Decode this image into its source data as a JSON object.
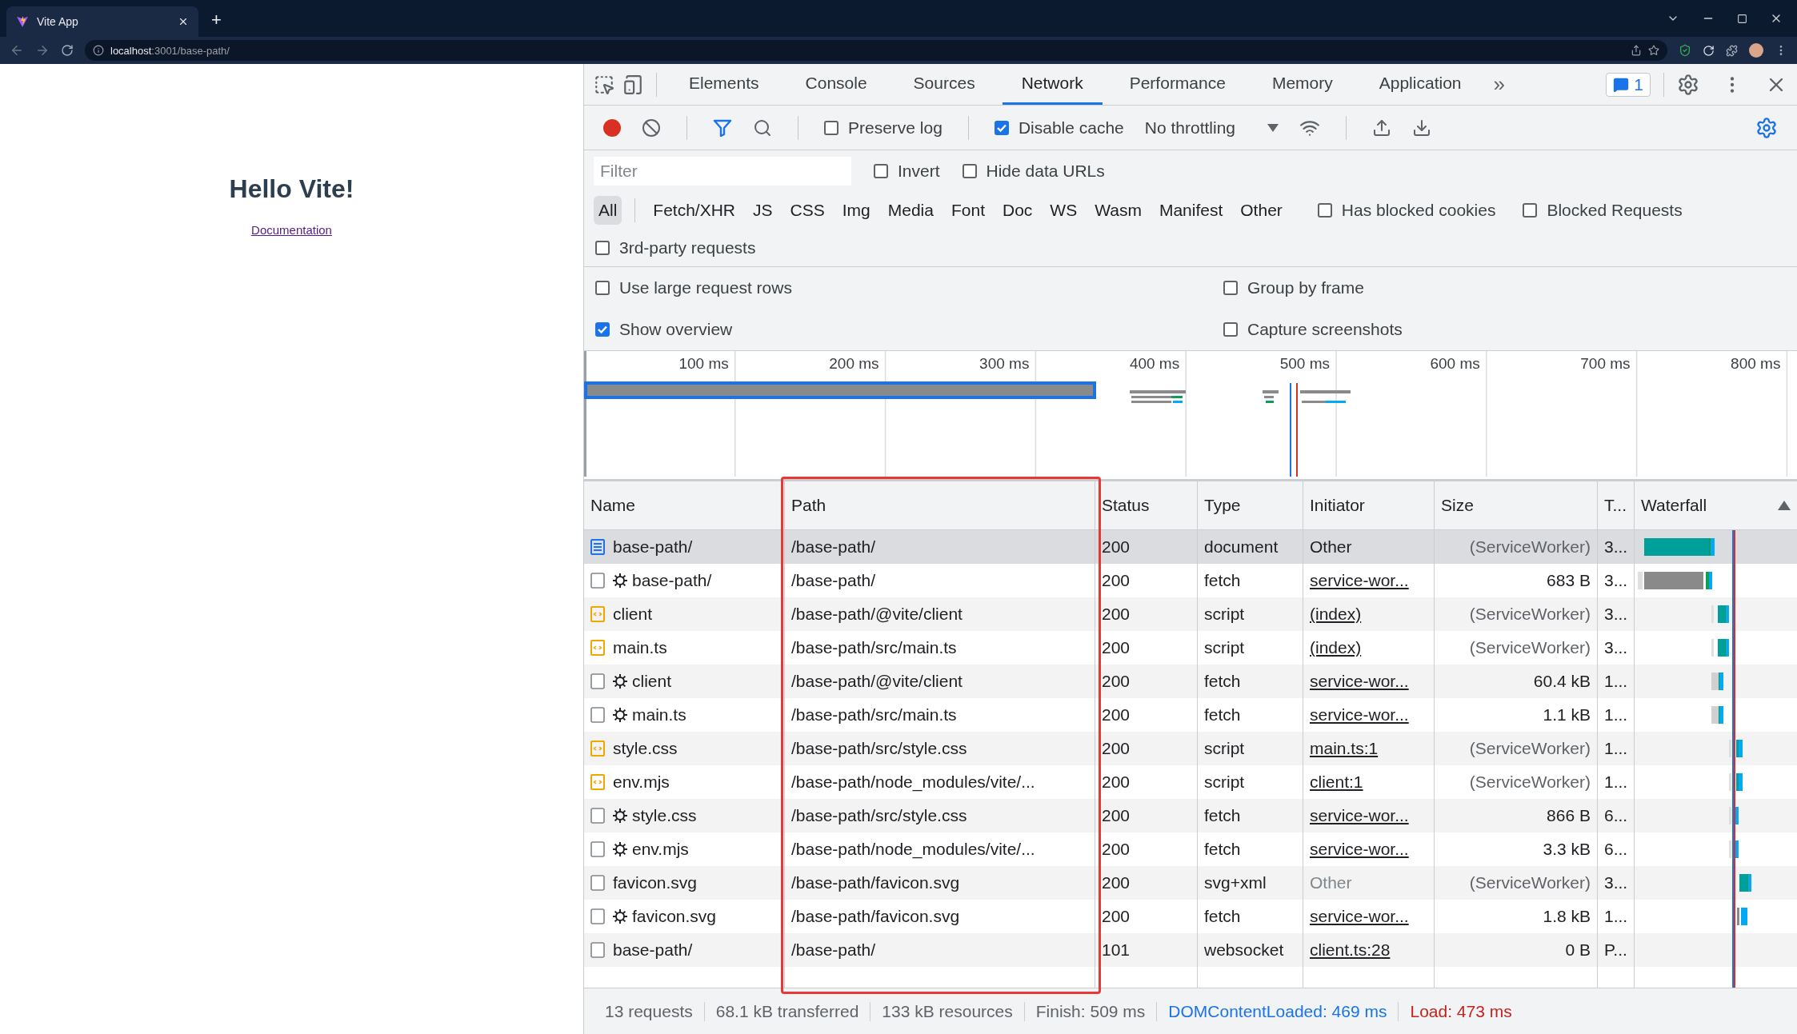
{
  "browser": {
    "tab_title": "Vite App",
    "new_tab": "+",
    "url_host": "localhost",
    "url_rest": ":3001/base-path/"
  },
  "page": {
    "heading": "Hello Vite!",
    "link": "Documentation"
  },
  "devtools": {
    "panel_tabs": [
      {
        "label": "Elements",
        "selected": false
      },
      {
        "label": "Console",
        "selected": false
      },
      {
        "label": "Sources",
        "selected": false
      },
      {
        "label": "Network",
        "selected": true
      },
      {
        "label": "Performance",
        "selected": false
      },
      {
        "label": "Memory",
        "selected": false
      },
      {
        "label": "Application",
        "selected": false
      }
    ],
    "more_tabs": "»",
    "issues_count": "1",
    "toolbar": {
      "recording": true,
      "preserve_log": {
        "label": "Preserve log",
        "checked": false
      },
      "disable_cache": {
        "label": "Disable cache",
        "checked": true
      },
      "throttling": "No throttling"
    },
    "filter": {
      "placeholder": "Filter",
      "invert": {
        "label": "Invert",
        "checked": false
      },
      "hide_data_urls": {
        "label": "Hide data URLs",
        "checked": false
      }
    },
    "type_filters": [
      {
        "label": "All",
        "selected": true
      },
      {
        "label": "Fetch/XHR",
        "selected": false
      },
      {
        "label": "JS",
        "selected": false
      },
      {
        "label": "CSS",
        "selected": false
      },
      {
        "label": "Img",
        "selected": false
      },
      {
        "label": "Media",
        "selected": false
      },
      {
        "label": "Font",
        "selected": false
      },
      {
        "label": "Doc",
        "selected": false
      },
      {
        "label": "WS",
        "selected": false
      },
      {
        "label": "Wasm",
        "selected": false
      },
      {
        "label": "Manifest",
        "selected": false
      },
      {
        "label": "Other",
        "selected": false
      }
    ],
    "has_blocked_cookies": {
      "label": "Has blocked cookies",
      "checked": false
    },
    "blocked_requests": {
      "label": "Blocked Requests",
      "checked": false
    },
    "third_party": {
      "label": "3rd-party requests",
      "checked": false
    },
    "settings": [
      {
        "label": "Use large request rows",
        "checked": false
      },
      {
        "label": "Group by frame",
        "checked": false
      },
      {
        "label": "Show overview",
        "checked": true
      },
      {
        "label": "Capture screenshots",
        "checked": false
      }
    ],
    "overview": {
      "ticks": [
        "100 ms",
        "200 ms",
        "300 ms",
        "400 ms",
        "500 ms",
        "600 ms",
        "700 ms",
        "800 ms"
      ]
    },
    "table": {
      "columns": [
        "Name",
        "Path",
        "Status",
        "Type",
        "Initiator",
        "Size",
        "T...",
        "Waterfall"
      ],
      "rows": [
        {
          "kind": "doc",
          "service_worker": false,
          "name": "base-path/",
          "path": "/base-path/",
          "status": "200",
          "type": "document",
          "initiator": {
            "text": "Other",
            "kind": "plain"
          },
          "size": "(ServiceWorker)",
          "size_muted": true,
          "time": "3...",
          "selected": true
        },
        {
          "kind": "file",
          "service_worker": true,
          "name": "base-path/",
          "path": "/base-path/",
          "status": "200",
          "type": "fetch",
          "initiator": {
            "text": "service-wor...",
            "kind": "link"
          },
          "size": "683 B",
          "size_muted": false,
          "time": "3...",
          "selected": false
        },
        {
          "kind": "code",
          "service_worker": false,
          "name": "client",
          "path": "/base-path/@vite/client",
          "status": "200",
          "type": "script",
          "initiator": {
            "text": "(index)",
            "kind": "link"
          },
          "size": "(ServiceWorker)",
          "size_muted": true,
          "time": "3...",
          "selected": false
        },
        {
          "kind": "code",
          "service_worker": false,
          "name": "main.ts",
          "path": "/base-path/src/main.ts",
          "status": "200",
          "type": "script",
          "initiator": {
            "text": "(index)",
            "kind": "link"
          },
          "size": "(ServiceWorker)",
          "size_muted": true,
          "time": "3...",
          "selected": false
        },
        {
          "kind": "file",
          "service_worker": true,
          "name": "client",
          "path": "/base-path/@vite/client",
          "status": "200",
          "type": "fetch",
          "initiator": {
            "text": "service-wor...",
            "kind": "link"
          },
          "size": "60.4 kB",
          "size_muted": false,
          "time": "1...",
          "selected": false
        },
        {
          "kind": "file",
          "service_worker": true,
          "name": "main.ts",
          "path": "/base-path/src/main.ts",
          "status": "200",
          "type": "fetch",
          "initiator": {
            "text": "service-wor...",
            "kind": "link"
          },
          "size": "1.1 kB",
          "size_muted": false,
          "time": "1...",
          "selected": false
        },
        {
          "kind": "code",
          "service_worker": false,
          "name": "style.css",
          "path": "/base-path/src/style.css",
          "status": "200",
          "type": "script",
          "initiator": {
            "text": "main.ts:1",
            "kind": "link"
          },
          "size": "(ServiceWorker)",
          "size_muted": true,
          "time": "1...",
          "selected": false
        },
        {
          "kind": "code",
          "service_worker": false,
          "name": "env.mjs",
          "path": "/base-path/node_modules/vite/...",
          "status": "200",
          "type": "script",
          "initiator": {
            "text": "client:1",
            "kind": "link"
          },
          "size": "(ServiceWorker)",
          "size_muted": true,
          "time": "1...",
          "selected": false
        },
        {
          "kind": "file",
          "service_worker": true,
          "name": "style.css",
          "path": "/base-path/src/style.css",
          "status": "200",
          "type": "fetch",
          "initiator": {
            "text": "service-wor...",
            "kind": "link"
          },
          "size": "866 B",
          "size_muted": false,
          "time": "6...",
          "selected": false
        },
        {
          "kind": "file",
          "service_worker": true,
          "name": "env.mjs",
          "path": "/base-path/node_modules/vite/...",
          "status": "200",
          "type": "fetch",
          "initiator": {
            "text": "service-wor...",
            "kind": "link"
          },
          "size": "3.3 kB",
          "size_muted": false,
          "time": "6...",
          "selected": false
        },
        {
          "kind": "file",
          "service_worker": false,
          "name": "favicon.svg",
          "path": "/base-path/favicon.svg",
          "status": "200",
          "type": "svg+xml",
          "initiator": {
            "text": "Other",
            "kind": "muted"
          },
          "size": "(ServiceWorker)",
          "size_muted": true,
          "time": "3...",
          "selected": false
        },
        {
          "kind": "file",
          "service_worker": true,
          "name": "favicon.svg",
          "path": "/base-path/favicon.svg",
          "status": "200",
          "type": "fetch",
          "initiator": {
            "text": "service-wor...",
            "kind": "link"
          },
          "size": "1.8 kB",
          "size_muted": false,
          "time": "1...",
          "selected": false
        },
        {
          "kind": "file",
          "service_worker": false,
          "name": "base-path/",
          "path": "/base-path/",
          "status": "101",
          "type": "websocket",
          "initiator": {
            "text": "client.ts:28",
            "kind": "link"
          },
          "size": "0 B",
          "size_muted": false,
          "time": "P...",
          "selected": false
        }
      ]
    },
    "status_bar": [
      {
        "text": "13 requests",
        "kind": "plain"
      },
      {
        "text": "68.1 kB transferred",
        "kind": "plain"
      },
      {
        "text": "133 kB resources",
        "kind": "plain"
      },
      {
        "text": "Finish: 509 ms",
        "kind": "plain"
      },
      {
        "text": "DOMContentLoaded: 469 ms",
        "kind": "dom"
      },
      {
        "text": "Load: 473 ms",
        "kind": "load"
      }
    ]
  }
}
